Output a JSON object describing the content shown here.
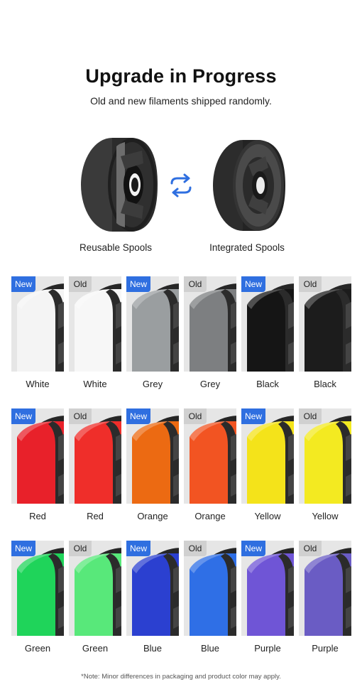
{
  "header": {
    "title": "Upgrade in Progress",
    "subtitle": "Old and new filaments shipped randomly."
  },
  "comparison": {
    "left_label": "Reusable Spools",
    "right_label": "Integrated Spools",
    "swap_icon": "swap-arrows-icon",
    "accent": "#2f6fe0"
  },
  "swatches": [
    {
      "badge": "New",
      "label": "White",
      "color": "#f4f4f4"
    },
    {
      "badge": "Old",
      "label": "White",
      "color": "#f7f7f7"
    },
    {
      "badge": "New",
      "label": "Grey",
      "color": "#9a9ea0"
    },
    {
      "badge": "Old",
      "label": "Grey",
      "color": "#7d7f81"
    },
    {
      "badge": "New",
      "label": "Black",
      "color": "#151515"
    },
    {
      "badge": "Old",
      "label": "Black",
      "color": "#1c1c1c"
    },
    {
      "badge": "New",
      "label": "Red",
      "color": "#e8212a"
    },
    {
      "badge": "Old",
      "label": "Red",
      "color": "#ef2e2a"
    },
    {
      "badge": "New",
      "label": "Orange",
      "color": "#ec6a12"
    },
    {
      "badge": "Old",
      "label": "Orange",
      "color": "#f25422"
    },
    {
      "badge": "New",
      "label": "Yellow",
      "color": "#f4e31a"
    },
    {
      "badge": "Old",
      "label": "Yellow",
      "color": "#f3ea21"
    },
    {
      "badge": "New",
      "label": "Green",
      "color": "#1fd45a"
    },
    {
      "badge": "Old",
      "label": "Green",
      "color": "#58e87a"
    },
    {
      "badge": "New",
      "label": "Blue",
      "color": "#2b40d0"
    },
    {
      "badge": "Old",
      "label": "Blue",
      "color": "#2f6fe6"
    },
    {
      "badge": "New",
      "label": "Purple",
      "color": "#6f55d6"
    },
    {
      "badge": "Old",
      "label": "Purple",
      "color": "#6a5cc4"
    }
  ],
  "footnote": "*Note: Minor differences in packaging and product color may apply."
}
